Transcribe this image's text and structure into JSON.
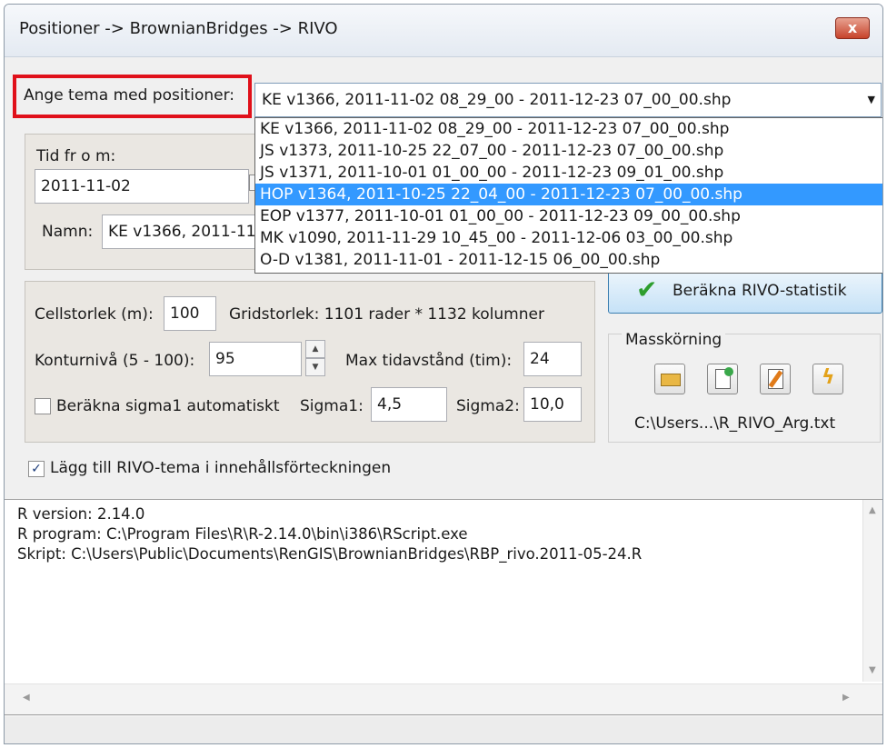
{
  "window": {
    "title": "Positioner -> BrownianBridges -> RIVO",
    "close_label": "x"
  },
  "theme": {
    "label": "Ange tema med positioner:",
    "selected": "KE v1366, 2011-11-02 08_29_00 - 2011-12-23 07_00_00.shp",
    "options": [
      "KE v1366, 2011-11-02 08_29_00 - 2011-12-23 07_00_00.shp",
      "JS v1373, 2011-10-25 22_07_00 - 2011-12-23 07_00_00.shp",
      "JS v1371, 2011-10-01 01_00_00 - 2011-12-23 09_01_00.shp",
      "HOP v1364, 2011-10-25 22_04_00 - 2011-12-23 07_00_00.shp",
      "EOP v1377, 2011-10-01 01_00_00 - 2011-12-23 09_00_00.shp",
      "MK v1090, 2011-11-29 10_45_00 - 2011-12-06 03_00_00.shp",
      "O-D v1381, 2011-11-01 - 2011-12-15 06_00_00.shp"
    ],
    "highlighted_index": 3
  },
  "time": {
    "label": "Tid fr o m:",
    "from_value": "2011-11-02"
  },
  "name": {
    "label": "Namn:",
    "value": "KE v1366, 2011-11"
  },
  "grid": {
    "cell_label": "Cellstorlek (m):",
    "cell_value": "100",
    "grid_size_text": "Gridstorlek: 1101 rader * 1132 kolumner",
    "contour_label": "Konturnivå (5 - 100):",
    "contour_value": "95",
    "max_label": "Max tidavstånd (tim):",
    "max_value": "24",
    "auto_sigma_label": "Beräkna sigma1 automatiskt",
    "auto_sigma_checked": false,
    "sigma1_label": "Sigma1:",
    "sigma1_value": "4,5",
    "sigma2_label": "Sigma2:",
    "sigma2_value": "10,0"
  },
  "compute_button_label": "Beräkna RIVO-statistik",
  "batch": {
    "label": "Masskörning",
    "path": "C:\\Users...\\R_RIVO_Arg.txt",
    "icons": [
      "open-folder-icon",
      "new-file-icon",
      "edit-file-icon",
      "run-lightning-icon"
    ]
  },
  "add_to_toc": {
    "label": "Lägg till RIVO-tema i innehållsförteckningen",
    "checked": true
  },
  "log": {
    "lines": [
      "R version: 2.14.0",
      "R program: C:\\Program Files\\R\\R-2.14.0\\bin\\i386\\RScript.exe",
      "Skript: C:\\Users\\Public\\Documents\\RenGIS\\BrownianBridges\\RBP_rivo.2011-05-24.R"
    ]
  },
  "colors": {
    "highlight": "#3399ff",
    "red_outline": "#e0101a",
    "check_green": "#2e9e2e"
  }
}
